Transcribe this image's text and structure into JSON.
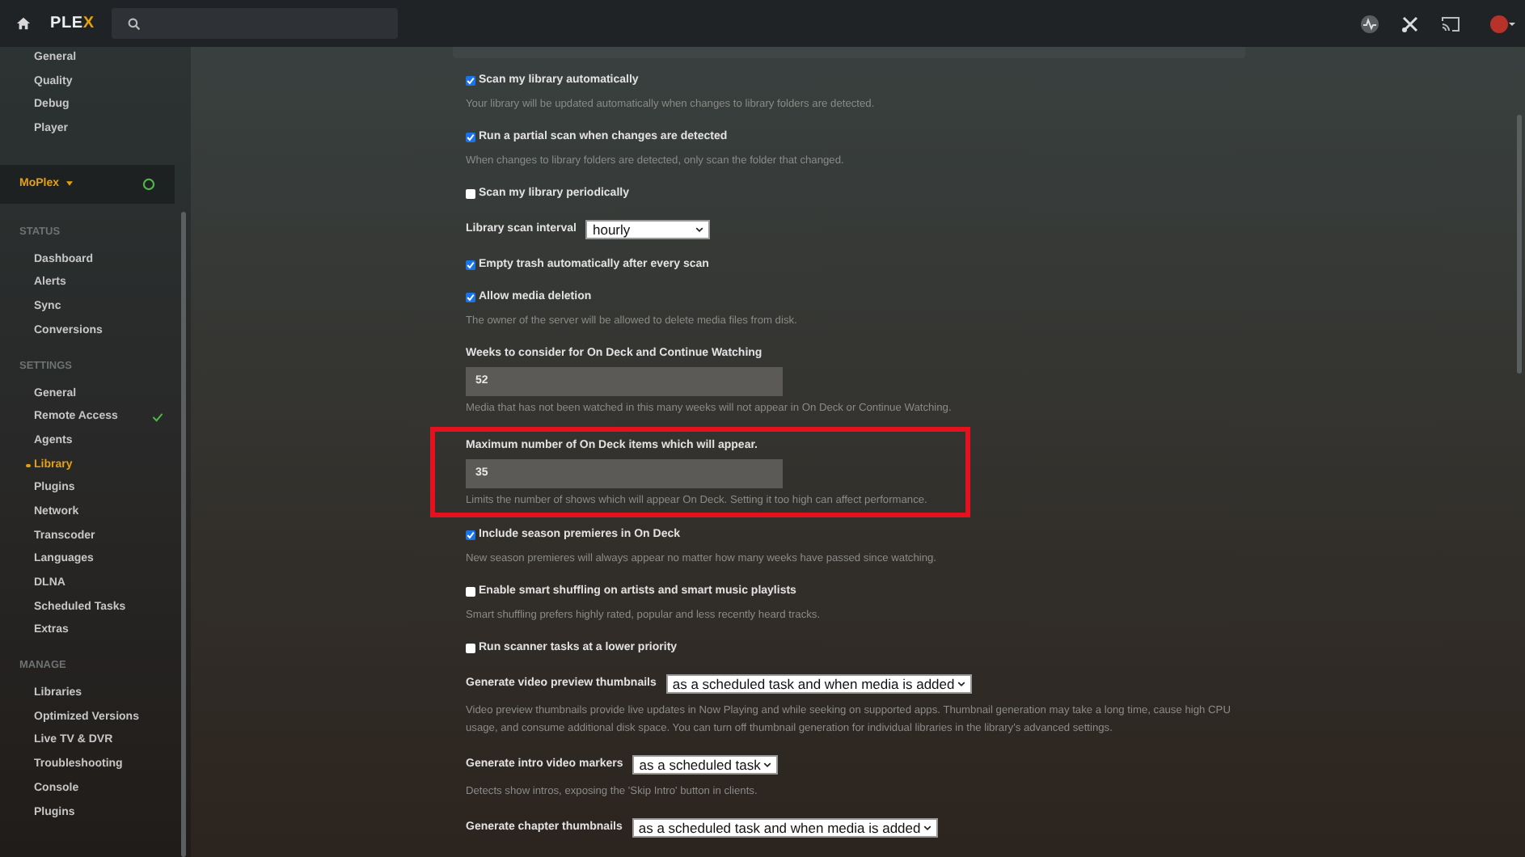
{
  "topbar": {
    "logo": {
      "main": "PLE",
      "accent": "X"
    }
  },
  "sidebar": {
    "groups": [
      {
        "items": [
          {
            "label": "General",
            "selected": false
          },
          {
            "label": "Quality",
            "selected": false
          },
          {
            "label": "Debug",
            "selected": false
          },
          {
            "label": "Player",
            "selected": false
          }
        ]
      },
      {
        "server": {
          "name": "MoPlex",
          "online": true
        }
      },
      {
        "heading": "STATUS",
        "items": [
          {
            "label": "Dashboard",
            "selected": false
          },
          {
            "label": "Alerts",
            "selected": false
          },
          {
            "label": "Sync",
            "selected": false
          },
          {
            "label": "Conversions",
            "selected": false
          }
        ]
      },
      {
        "heading": "SETTINGS",
        "items": [
          {
            "label": "General",
            "selected": false,
            "verified": false
          },
          {
            "label": "Remote Access",
            "selected": false,
            "verified": true
          },
          {
            "label": "Agents",
            "selected": false,
            "verified": false
          },
          {
            "label": "Library",
            "selected": true,
            "verified": false
          },
          {
            "label": "Plugins",
            "selected": false,
            "verified": false
          },
          {
            "label": "Network",
            "selected": false,
            "verified": false
          },
          {
            "label": "Transcoder",
            "selected": false,
            "verified": false
          },
          {
            "label": "Languages",
            "selected": false,
            "verified": false
          },
          {
            "label": "DLNA",
            "selected": false,
            "verified": false
          },
          {
            "label": "Scheduled Tasks",
            "selected": false,
            "verified": false
          },
          {
            "label": "Extras",
            "selected": false,
            "verified": false
          }
        ]
      },
      {
        "heading": "MANAGE",
        "items": [
          {
            "label": "Libraries",
            "selected": false
          },
          {
            "label": "Optimized Versions",
            "selected": false
          },
          {
            "label": "Live TV & DVR",
            "selected": false
          },
          {
            "label": "Troubleshooting",
            "selected": false
          },
          {
            "label": "Console",
            "selected": false
          },
          {
            "label": "Plugins",
            "selected": false
          }
        ]
      }
    ]
  },
  "settings": [
    {
      "kind": "checkbox",
      "label": "Scan my library automatically",
      "checked": true,
      "description": "Your library will be updated automatically when changes to library folders are detected."
    },
    {
      "kind": "checkbox",
      "label": "Run a partial scan when changes are detected",
      "checked": true,
      "description": "When changes to library folders are detected, only scan the folder that changed."
    },
    {
      "kind": "checkbox",
      "label": "Scan my library periodically",
      "checked": false
    },
    {
      "kind": "select",
      "label": "Library scan interval",
      "value": "hourly"
    },
    {
      "kind": "checkbox",
      "label": "Empty trash automatically after every scan",
      "checked": true
    },
    {
      "kind": "checkbox",
      "label": "Allow media deletion",
      "checked": true,
      "description": "The owner of the server will be allowed to delete media files from disk."
    },
    {
      "kind": "number",
      "label": "Weeks to consider for On Deck and Continue Watching",
      "value": "52",
      "description": "Media that has not been watched in this many weeks will not appear in On Deck or Continue Watching.",
      "highlighted": false
    },
    {
      "kind": "number",
      "label": "Maximum number of On Deck items which will appear.",
      "value": "35",
      "description": "Limits the number of shows which will appear On Deck. Setting it too high can affect performance.",
      "highlighted": true
    },
    {
      "kind": "checkbox",
      "label": "Include season premieres in On Deck",
      "checked": true,
      "description": "New season premieres will always appear no matter how many weeks have passed since watching."
    },
    {
      "kind": "checkbox",
      "label": "Enable smart shuffling on artists and smart music playlists",
      "checked": false,
      "description": "Smart shuffling prefers highly rated, popular and less recently heard tracks."
    },
    {
      "kind": "checkbox",
      "label": "Run scanner tasks at a lower priority",
      "checked": false
    },
    {
      "kind": "select",
      "label": "Generate video preview thumbnails",
      "value": "as a scheduled task and when media is added",
      "description": "Video preview thumbnails provide live updates in Now Playing and while seeking on supported apps. Thumbnail generation may take a long time, cause high CPU usage, and consume additional disk space. You can turn off thumbnail generation for individual libraries in the library's advanced settings."
    },
    {
      "kind": "select",
      "label": "Generate intro video markers",
      "value": "as a scheduled task",
      "description": "Detects show intros, exposing the 'Skip Intro' button in clients."
    },
    {
      "kind": "select",
      "label": "Generate chapter thumbnails",
      "value": "as a scheduled task and when media is added"
    }
  ]
}
